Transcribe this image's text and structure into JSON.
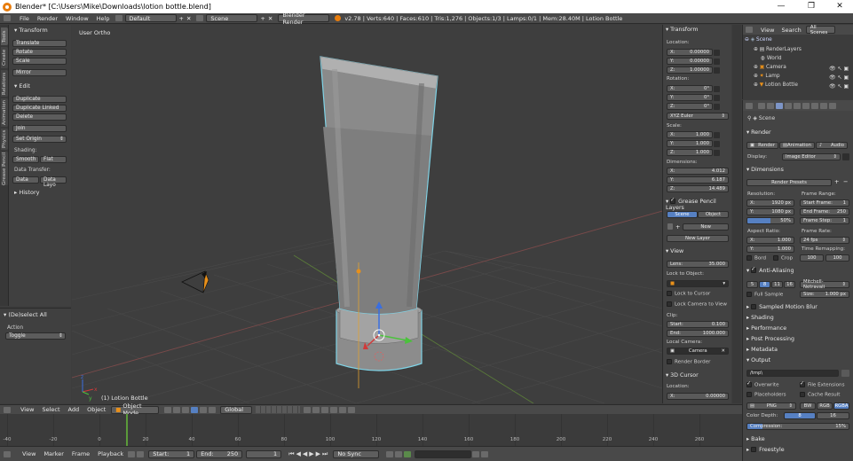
{
  "window": {
    "title": "Blender* [C:\\Users\\Mike\\Downloads\\lotion bottle.blend]",
    "minimize": "—",
    "maximize": "❐",
    "close": "✕"
  },
  "menubar": {
    "items": [
      "File",
      "Render",
      "Window",
      "Help"
    ],
    "layout": "Default",
    "scene": "Scene",
    "engine": "Blender Render",
    "stats": "v2.78 | Verts:640 | Faces:610 | Tris:1,276 | Objects:1/3 | Lamps:0/1 | Mem:28.40M | Lotion Bottle"
  },
  "tool_tabs": [
    "Tools",
    "Create",
    "Relations",
    "Animation",
    "Physics",
    "Grease Pencil"
  ],
  "toolshelf": {
    "transform_header": "Transform",
    "transform_buttons": [
      "Translate",
      "Rotate",
      "Scale",
      "Mirror"
    ],
    "edit_header": "Edit",
    "edit_buttons": [
      "Duplicate",
      "Duplicate Linked",
      "Delete",
      "Join"
    ],
    "set_origin": "Set Origin",
    "shading_label": "Shading:",
    "smooth": "Smooth",
    "flat": "Flat",
    "data_transfer_label": "Data Transfer:",
    "data": "Data",
    "data_layo": "Data Layo",
    "history_header": "History"
  },
  "operator_panel": {
    "header": "(De)select All",
    "action_label": "Action",
    "action_value": "Toggle"
  },
  "viewport": {
    "view_label": "User Ortho",
    "object_label": "(1) Lotion Bottle",
    "axis_x": "x",
    "axis_y": "y",
    "axis_z": "z"
  },
  "npanel": {
    "transform_header": "Transform",
    "location_label": "Location:",
    "location": [
      {
        "axis": "X:",
        "value": "0.00000"
      },
      {
        "axis": "Y:",
        "value": "0.00000"
      },
      {
        "axis": "Z:",
        "value": "1.00000"
      }
    ],
    "rotation_label": "Rotation:",
    "rotation": [
      {
        "axis": "X:",
        "value": "0°"
      },
      {
        "axis": "Y:",
        "value": "0°"
      },
      {
        "axis": "Z:",
        "value": "0°"
      }
    ],
    "rotation_mode": "XYZ Euler",
    "scale_label": "Scale:",
    "scale": [
      {
        "axis": "X:",
        "value": "1.000"
      },
      {
        "axis": "Y:",
        "value": "1.000"
      },
      {
        "axis": "Z:",
        "value": "1.000"
      }
    ],
    "dimensions_label": "Dimensions:",
    "dimensions": [
      {
        "axis": "X:",
        "value": "4.012"
      },
      {
        "axis": "Y:",
        "value": "6.187"
      },
      {
        "axis": "Z:",
        "value": "14.489"
      }
    ],
    "grease_header": "Grease Pencil Layers",
    "gp_scene": "Scene",
    "gp_object": "Object",
    "gp_new": "New",
    "gp_new_layer": "New Layer",
    "view_header": "View",
    "lens_label": "Lens:",
    "lens_value": "35.000",
    "lock_object_label": "Lock to Object:",
    "lock_cursor": "Lock to Cursor",
    "lock_camera": "Lock Camera to View",
    "clip_label": "Clip:",
    "clip_start_label": "Start:",
    "clip_start": "0.100",
    "clip_end_label": "End:",
    "clip_end": "1000.000",
    "local_camera_label": "Local Camera:",
    "local_camera": "Camera",
    "render_border": "Render Border",
    "cursor_header": "3D Cursor",
    "cursor_location_label": "Location:",
    "cursor_x_axis": "X:",
    "cursor_x": "0.00000"
  },
  "outliner": {
    "menu": [
      "View",
      "Search"
    ],
    "filter": "All Scenes",
    "items": [
      "Scene",
      "RenderLayers",
      "World",
      "Camera",
      "Lamp",
      "Lotion Bottle"
    ]
  },
  "properties": {
    "context": "Scene",
    "render_header": "Render",
    "render_btn": "Render",
    "animation_btn": "Animation",
    "audio_btn": "Audio",
    "display_label": "Display:",
    "display_value": "Image Editor",
    "dimensions_header": "Dimensions",
    "render_presets": "Render Presets",
    "resolution_label": "Resolution:",
    "res_x_label": "X:",
    "res_x": "1920 px",
    "res_y_label": "Y:",
    "res_y": "1080 px",
    "res_pct": "50%",
    "frame_range_label": "Frame Range:",
    "start_frame": "Start Frame:",
    "start_frame_value": "1",
    "end_frame": "End Frame:",
    "end_frame_value": "250",
    "frame_step": "Frame Step:",
    "frame_step_value": "1",
    "aspect_label": "Aspect Ratio:",
    "aspect_x_label": "X:",
    "aspect_x": "1.000",
    "aspect_y_label": "Y:",
    "aspect_y": "1.000",
    "frame_rate_label": "Frame Rate:",
    "frame_rate": "24 fps",
    "time_remap_label": "Time Remapping:",
    "remap_old": "100",
    "remap_new": "100",
    "bord": "Bord",
    "crop": "Crop",
    "aa_header": "Anti-Aliasing",
    "aa_samples": [
      "5",
      "8",
      "11",
      "16"
    ],
    "aa_filter": "Mitchell-Netravali",
    "full_sample": "Full Sample",
    "aa_size_label": "Size:",
    "aa_size": "1.000 px",
    "sampled_motion_blur": "Sampled Motion Blur",
    "shading": "Shading",
    "performance": "Performance",
    "post_processing": "Post Processing",
    "metadata": "Metadata",
    "output_header": "Output",
    "output_path": "/tmp\\",
    "overwrite": "Overwrite",
    "file_extensions": "File Extensions",
    "placeholders": "Placeholders",
    "cache_result": "Cache Result",
    "format": "PNG",
    "bw": "BW",
    "rgb": "RGB",
    "rgba": "RGBA",
    "color_depth_label": "Color Depth:",
    "depth_8": "8",
    "depth_16": "16",
    "compression_label": "Compression:",
    "compression": "15%",
    "compression_fraction": 0.15,
    "bake": "Bake",
    "freestyle": "Freestyle"
  },
  "viewport_header": {
    "menus": [
      "View",
      "Select",
      "Add",
      "Object"
    ],
    "mode": "Object Mode",
    "orientation": "Global"
  },
  "timeline": {
    "ticks": [
      "-40",
      "-20",
      "0",
      "20",
      "40",
      "60",
      "80",
      "100",
      "120",
      "140",
      "160",
      "180",
      "200",
      "220",
      "240",
      "260"
    ],
    "menus": [
      "View",
      "Marker",
      "Frame",
      "Playback"
    ],
    "start_label": "Start:",
    "start_value": "1",
    "end_label": "End:",
    "end_value": "250",
    "current_frame": "1",
    "sync": "No Sync"
  }
}
